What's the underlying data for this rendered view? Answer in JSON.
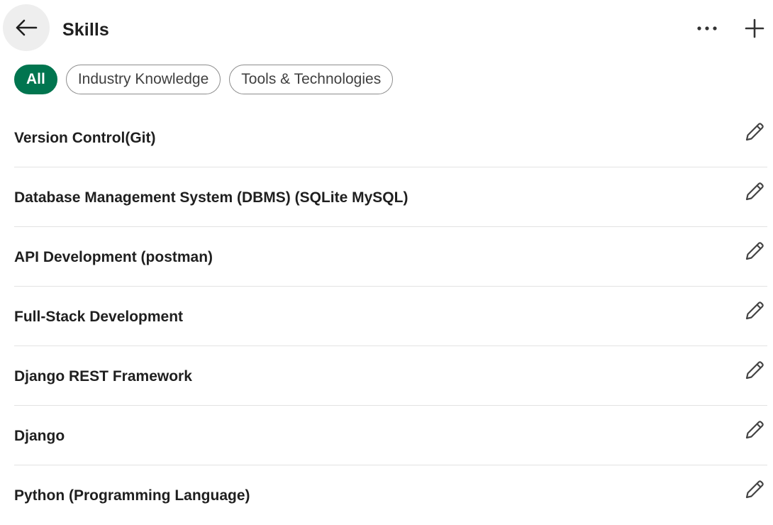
{
  "header": {
    "title": "Skills",
    "back_icon": "arrow-left-icon",
    "more_icon": "more-horizontal-icon",
    "add_icon": "plus-icon"
  },
  "filters": [
    {
      "label": "All",
      "selected": true
    },
    {
      "label": "Industry Knowledge",
      "selected": false
    },
    {
      "label": "Tools & Technologies",
      "selected": false
    }
  ],
  "skills": [
    {
      "name": "Version Control(Git)"
    },
    {
      "name": "Database Management System (DBMS) (SQLite MySQL)"
    },
    {
      "name": "API Development (postman)"
    },
    {
      "name": "Full-Stack Development"
    },
    {
      "name": "Django REST Framework"
    },
    {
      "name": "Django"
    },
    {
      "name": "Python (Programming Language)"
    }
  ],
  "colors": {
    "accent": "#01754f",
    "text": "#1f1f1f",
    "divider": "#e3e3e3",
    "back_button_bg": "#eeeeee"
  },
  "icons": {
    "edit": "pencil-icon"
  }
}
